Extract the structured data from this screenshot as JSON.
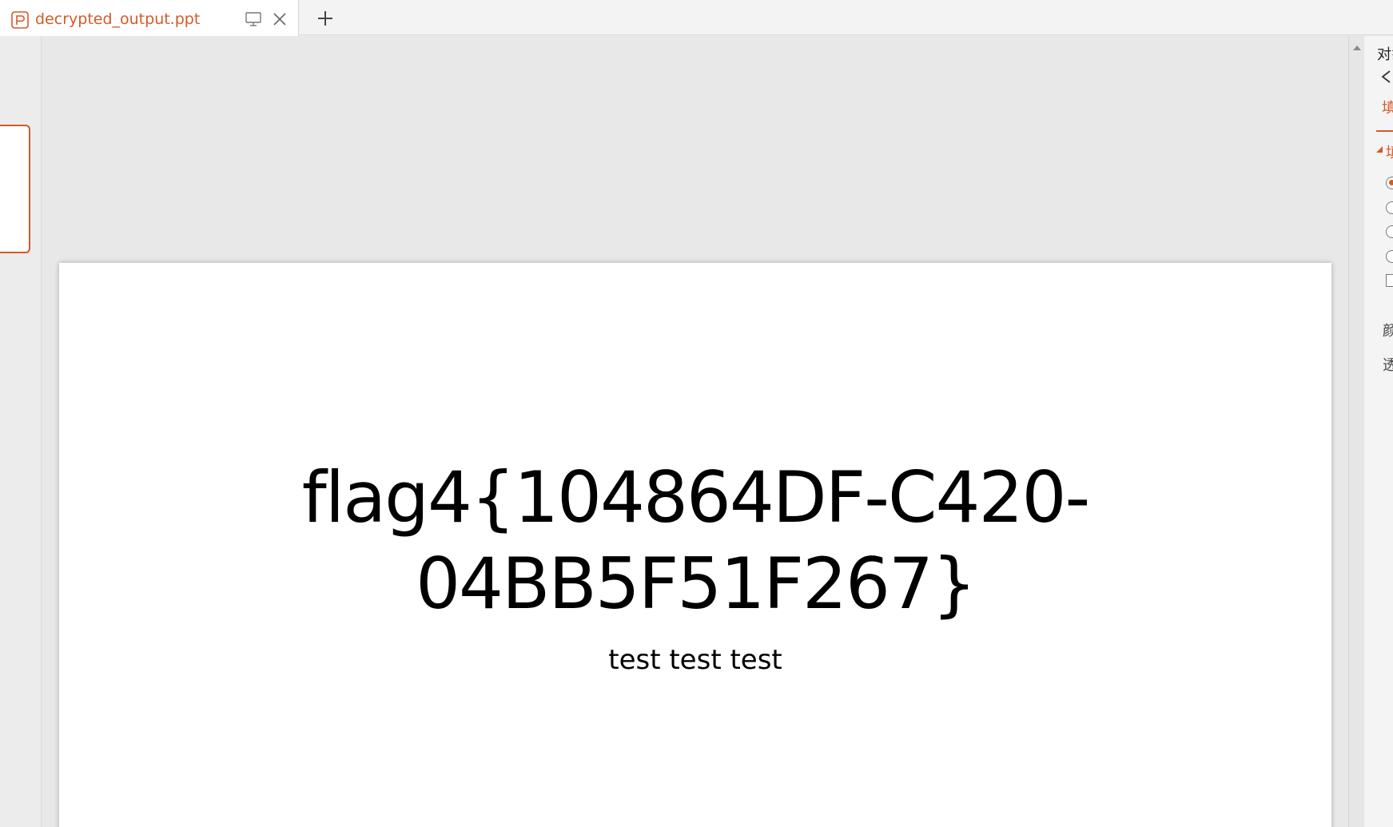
{
  "tab": {
    "title": "decrypted_output.ppt"
  },
  "slide": {
    "title_line1": "flag4{104864DF-C420-",
    "title_line2": "04BB5F51F267}",
    "subtitle": "test test test"
  },
  "property_panel": {
    "label_object": "对象",
    "label_tab": "填",
    "label_section": "填",
    "label_color": "颜",
    "label_transparency": "透"
  },
  "colors": {
    "accent": "#d35a2a",
    "canvas": "#e8e8e8",
    "slide": "#ffffff"
  }
}
